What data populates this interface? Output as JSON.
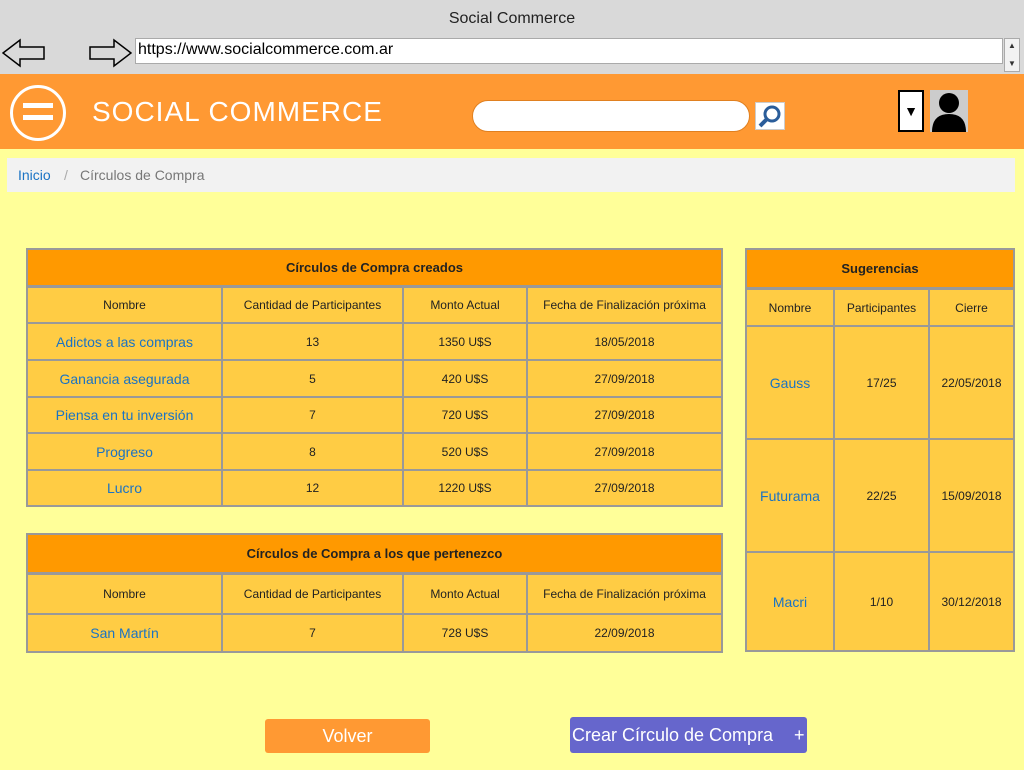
{
  "browser": {
    "title": "Social Commerce",
    "url": "https://www.socialcommerce.com.ar"
  },
  "header": {
    "brand": "SOCIAL COMMERCE",
    "search_placeholder": "",
    "dropdown_caret": "▼"
  },
  "breadcrumb": {
    "home": "Inicio",
    "separator": "/",
    "current": "Círculos de Compra"
  },
  "created": {
    "title": "Círculos de Compra creados",
    "columns": [
      "Nombre",
      "Cantidad de Participantes",
      "Monto Actual",
      "Fecha de Finalización próxima"
    ],
    "rows": [
      [
        "Adictos a las compras",
        "13",
        "1350 U$S",
        "18/05/2018"
      ],
      [
        "Ganancia asegurada",
        "5",
        "420 U$S",
        "27/09/2018"
      ],
      [
        "Piensa en tu inversión",
        "7",
        "720 U$S",
        "27/09/2018"
      ],
      [
        "Progreso",
        "8",
        "520 U$S",
        "27/09/2018"
      ],
      [
        "Lucro",
        "12",
        "1220 U$S",
        "27/09/2018"
      ]
    ]
  },
  "member": {
    "title": "Círculos de Compra a los que pertenezco",
    "columns": [
      "Nombre",
      "Cantidad de Participantes",
      "Monto Actual",
      "Fecha de Finalización próxima"
    ],
    "rows": [
      [
        "San Martín",
        "7",
        "728 U$S",
        "22/09/2018"
      ]
    ]
  },
  "suggestions": {
    "title": "Sugerencias",
    "columns": [
      "Nombre",
      "Participantes",
      "Cierre"
    ],
    "rows": [
      [
        "Gauss",
        "17/25",
        "22/05/2018"
      ],
      [
        "Futurama",
        "22/25",
        "15/09/2018"
      ],
      [
        "Macri",
        "1/10",
        "30/12/2018"
      ]
    ]
  },
  "buttons": {
    "back": "Volver",
    "create": "Crear Círculo de Compra",
    "create_plus": "+"
  },
  "colors": {
    "header": "#ff9933",
    "page_bg": "#ffff99",
    "table_bg": "#ffcc44",
    "table_header": "#ff9900",
    "link": "#1a73c4",
    "create_button": "#6666cc"
  }
}
